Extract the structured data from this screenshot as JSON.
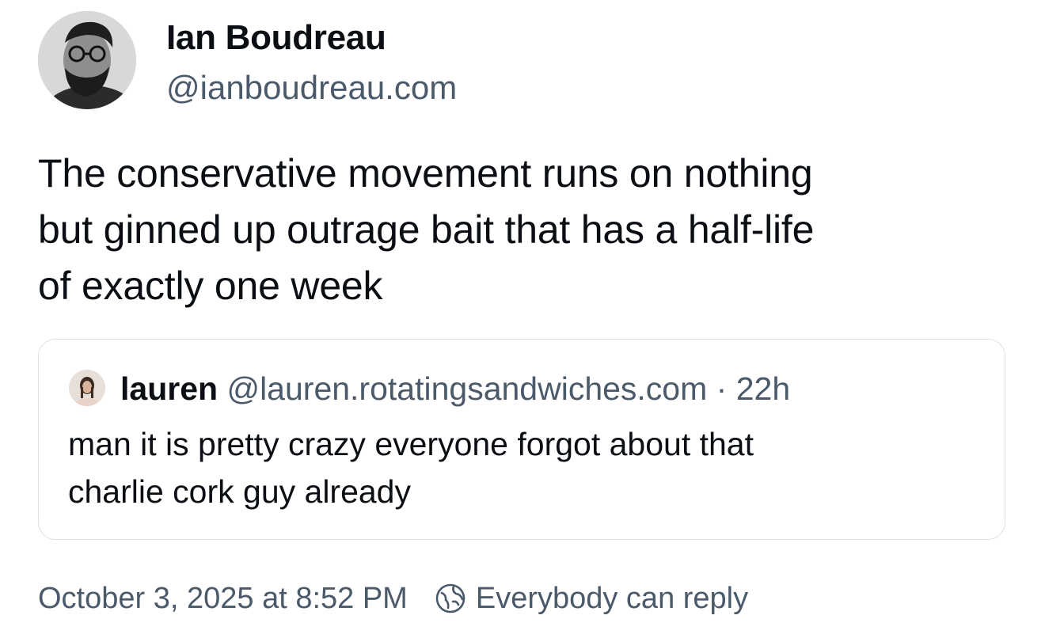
{
  "author": {
    "name": "Ian Boudreau",
    "handle": "@ianboudreau.com",
    "avatar_icon": "avatar-photo"
  },
  "post": {
    "text_lines": [
      "The conservative movement runs on nothing",
      "but ginned up outrage bait that has a half-life",
      "of exactly one week"
    ]
  },
  "quote": {
    "author_name": "lauren",
    "author_handle": "@lauren.rotatingsandwiches.com",
    "separator": "·",
    "time": "22h",
    "text_lines": [
      "man it is pretty crazy everyone forgot about that",
      "charlie cork guy already"
    ],
    "avatar_icon": "avatar-photo"
  },
  "footer": {
    "timestamp": "October 3, 2025 at 8:52 PM",
    "reply_setting": "Everybody can reply",
    "reply_icon": "globe-icon"
  },
  "colors": {
    "text": "#0b0f14",
    "secondary": "#4b5a6a",
    "border": "#dbe1e7",
    "background": "#ffffff"
  }
}
